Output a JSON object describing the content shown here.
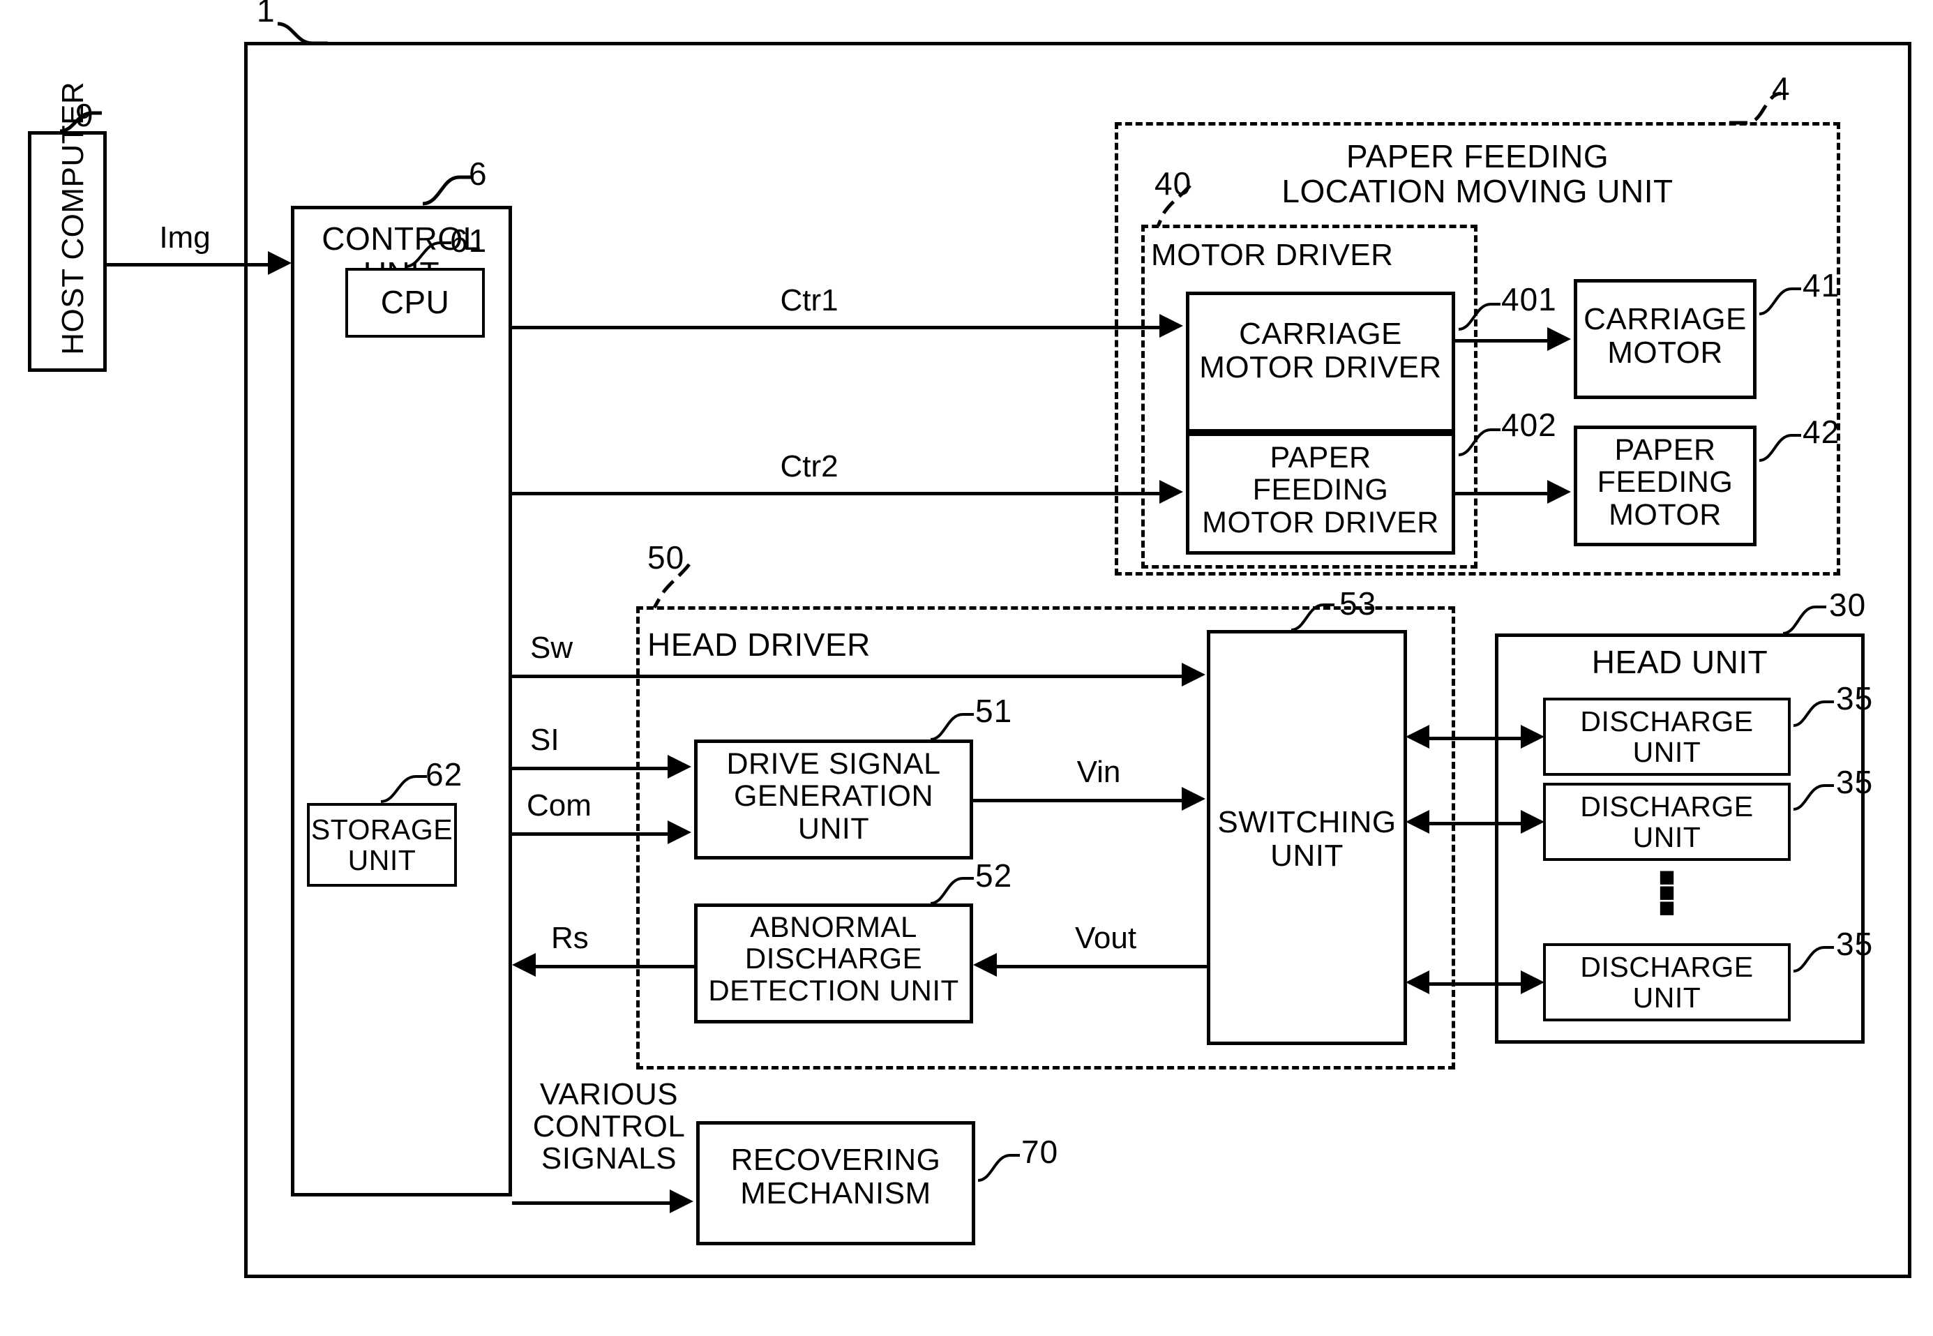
{
  "diagram": {
    "figure_refs": {
      "printer": "1",
      "host_computer": "9",
      "control_unit": "6",
      "cpu": "61",
      "storage_unit": "62",
      "paper_feeding_location_moving_unit": "4",
      "motor_driver": "40",
      "carriage_motor_driver": "401",
      "paper_feeding_motor_driver": "402",
      "carriage_motor": "41",
      "paper_feeding_motor": "42",
      "head_driver": "50",
      "drive_signal_generation_unit": "51",
      "abnormal_discharge_detection_unit": "52",
      "switching_unit": "53",
      "head_unit": "30",
      "discharge_unit": "35",
      "recovering_mechanism": "70"
    },
    "blocks": {
      "host_computer": "HOST COMPUTER",
      "control_unit": "CONTROL\nUNIT",
      "cpu": "CPU",
      "storage_unit": "STORAGE\nUNIT",
      "paper_feeding_location_moving_unit": "PAPER FEEDING\nLOCATION MOVING UNIT",
      "motor_driver": "MOTOR DRIVER",
      "carriage_motor_driver": "CARRIAGE\nMOTOR DRIVER",
      "paper_feeding_motor_driver": "PAPER\nFEEDING\nMOTOR DRIVER",
      "carriage_motor": "CARRIAGE\nMOTOR",
      "paper_feeding_motor": "PAPER\nFEEDING\nMOTOR",
      "head_driver": "HEAD DRIVER",
      "drive_signal_generation_unit": "DRIVE SIGNAL\nGENERATION\nUNIT",
      "abnormal_discharge_detection_unit": "ABNORMAL\nDISCHARGE\nDETECTION UNIT",
      "switching_unit": "SWITCHING\nUNIT",
      "head_unit": "HEAD UNIT",
      "discharge_unit_1": "DISCHARGE\nUNIT",
      "discharge_unit_2": "DISCHARGE\nUNIT",
      "discharge_unit_3": "DISCHARGE\nUNIT",
      "recovering_mechanism": "RECOVERING\nMECHANISM",
      "vertical_ellipsis": "."
    },
    "signals": {
      "img": "Img",
      "ctr1": "Ctr1",
      "ctr2": "Ctr2",
      "sw": "Sw",
      "si": "SI",
      "com": "Com",
      "rs": "Rs",
      "vin": "Vin",
      "vout": "Vout",
      "various_control_signals": "VARIOUS\nCONTROL\nSIGNALS"
    },
    "colors": {
      "stroke": "#000000",
      "background": "#ffffff"
    }
  }
}
